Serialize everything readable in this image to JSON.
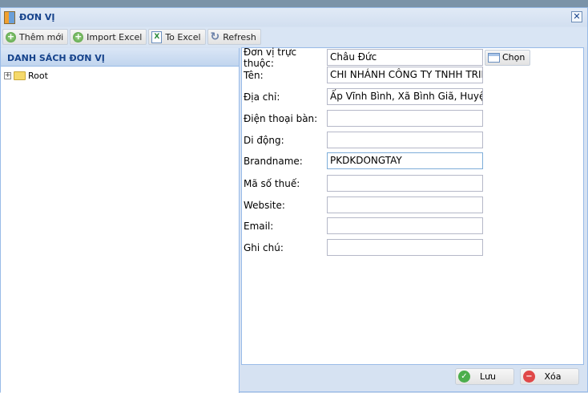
{
  "window": {
    "title": "ĐƠN VỊ",
    "close": "✕"
  },
  "toolbar": {
    "add": "Thêm mới",
    "import": "Import Excel",
    "export": "To Excel",
    "refresh": "Refresh"
  },
  "left": {
    "header": "DANH SÁCH ĐƠN VỊ",
    "tree": [
      {
        "label": "Root",
        "expander": "+"
      }
    ]
  },
  "form": {
    "parent": {
      "label": "Đơn vị trực thuộc:",
      "value": "Châu Đức",
      "button": "Chọn"
    },
    "fields": [
      {
        "label": "Tên:",
        "value": "CHI NHÁNH CÔNG TY TNHH TRIỆU"
      },
      {
        "label": "Địa chỉ:",
        "value": "Ấp Vĩnh Bình, Xã Bình Giã, Huyện C"
      },
      {
        "label": "Điện thoại bàn:",
        "value": ""
      },
      {
        "label": "Di động:",
        "value": ""
      },
      {
        "label": "Brandname:",
        "value": "PKDKDONGTAY"
      },
      {
        "label": "Mã số thuế:",
        "value": ""
      },
      {
        "label": "Website:",
        "value": ""
      },
      {
        "label": "Email:",
        "value": ""
      },
      {
        "label": "Ghi chú:",
        "value": ""
      }
    ]
  },
  "footer": {
    "save": "Lưu",
    "delete": "Xóa"
  }
}
